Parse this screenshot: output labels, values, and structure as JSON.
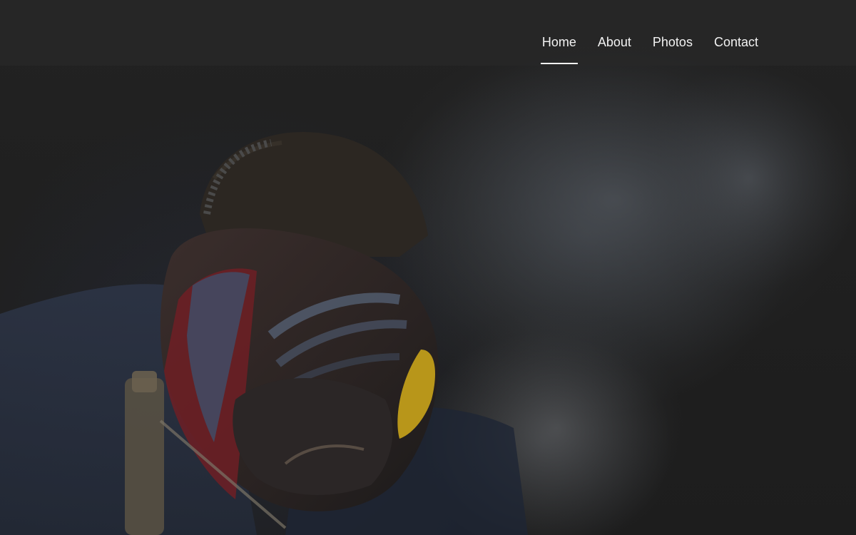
{
  "nav": {
    "items": [
      {
        "label": "Home",
        "active": true
      },
      {
        "label": "About",
        "active": false
      },
      {
        "label": "Photos",
        "active": false
      },
      {
        "label": "Contact",
        "active": false
      }
    ]
  },
  "hero": {
    "image_subject": "welder-with-helmet-and-smoke"
  },
  "colors": {
    "background": "#1f1f1f",
    "nav_text": "#f2f2f2",
    "helmet_stripe_red": "#6e1f24",
    "helmet_stripe_blue": "#3e4f6a",
    "torch_flame": "#c9a31a"
  }
}
